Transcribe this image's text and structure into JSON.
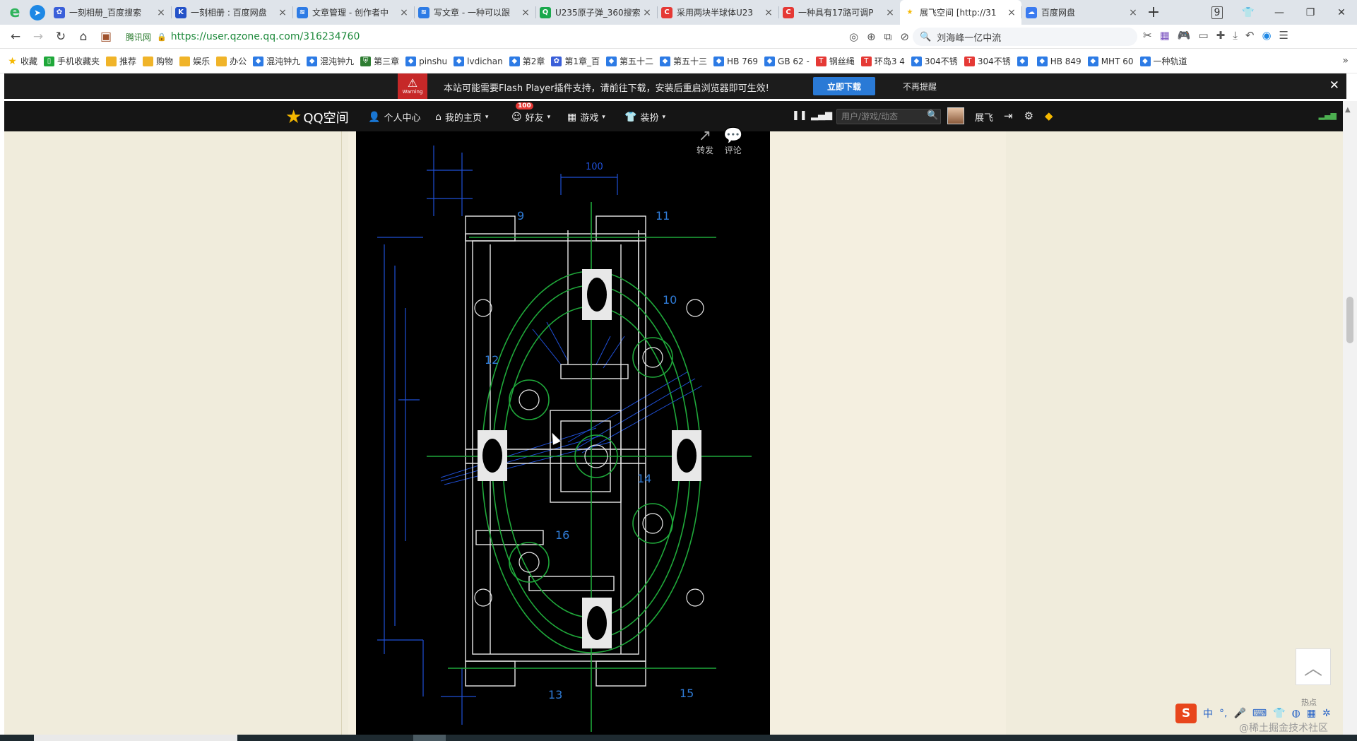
{
  "tabs": [
    {
      "title": "一刻相册_百度搜索",
      "icon": "baidu-paw-icon",
      "color": "#3a5fd9"
    },
    {
      "title": "一刻相册 : 百度网盘",
      "icon": "onemoment-icon",
      "color": "#2452c8"
    },
    {
      "title": "文章管理 - 创作者中",
      "icon": "layers-icon",
      "color": "#2d7be5"
    },
    {
      "title": "写文章 - 一种可以跟",
      "icon": "layers-icon",
      "color": "#2d7be5"
    },
    {
      "title": "U235原子弹_360搜索",
      "icon": "360-search-icon",
      "color": "#19a84c"
    },
    {
      "title": "采用两块半球体U23",
      "icon": "csdn-c-icon",
      "color": "#e53935"
    },
    {
      "title": "一种具有17路可调P",
      "icon": "csdn-c-icon",
      "color": "#e53935"
    },
    {
      "title": "展飞空间 [http://31",
      "icon": "star-icon",
      "color": "#f5b800"
    },
    {
      "title": "百度网盘",
      "icon": "baidu-netdisk-icon",
      "color": "#3b7bf0"
    }
  ],
  "window": {
    "tab_count": "9"
  },
  "address": {
    "secure_label": "腾讯网",
    "url": "https://user.qzone.qq.com/316234760",
    "search_text": "刘海峰一亿中流"
  },
  "bookmarks": [
    {
      "label": "收藏",
      "icon": "star-icon"
    },
    {
      "label": "手机收藏夹",
      "icon": "phone-icon"
    },
    {
      "label": "推荐",
      "icon": "folder-icon"
    },
    {
      "label": "购物",
      "icon": "folder-icon"
    },
    {
      "label": "娱乐",
      "icon": "folder-icon"
    },
    {
      "label": "办公",
      "icon": "folder-icon"
    },
    {
      "label": "混沌钟九",
      "icon": "site-icon"
    },
    {
      "label": "混沌钟九",
      "icon": "site-icon"
    },
    {
      "label": "第三章",
      "icon": "shield-icon"
    },
    {
      "label": "pinshu",
      "icon": "site-icon"
    },
    {
      "label": "lvdichan",
      "icon": "site-icon"
    },
    {
      "label": "第2章",
      "icon": "site-icon"
    },
    {
      "label": "第1章_百",
      "icon": "baidu-paw-icon"
    },
    {
      "label": "第五十二",
      "icon": "site-icon"
    },
    {
      "label": "第五十三",
      "icon": "site-icon"
    },
    {
      "label": "HB 769",
      "icon": "site-icon"
    },
    {
      "label": "GB 62 -",
      "icon": "site-icon"
    },
    {
      "label": "钢丝绳",
      "icon": "t-icon"
    },
    {
      "label": "环岛3 4",
      "icon": "t-icon"
    },
    {
      "label": "304不锈",
      "icon": "site-icon"
    },
    {
      "label": "304不锈",
      "icon": "t-icon"
    },
    {
      "label": "",
      "icon": "site-icon"
    },
    {
      "label": "HB 849",
      "icon": "site-icon"
    },
    {
      "label": "MHT 60",
      "icon": "site-icon"
    },
    {
      "label": "一种轨道",
      "icon": "site-icon"
    }
  ],
  "flash_notice": {
    "warning_label": "Warning",
    "message": "本站可能需要Flash Player插件支持，请前往下载，安装后重启浏览器即可生效!",
    "download_label": "立即下载",
    "dismiss_label": "不再提醒"
  },
  "qzone_nav": {
    "logo_label": "QQ空间",
    "personal_center": "个人中心",
    "my_home": "我的主页",
    "friends": "好友",
    "friends_badge": "100",
    "games": "游戏",
    "decorate": "装扮",
    "search_placeholder": "用户/游戏/动态",
    "username": "展飞"
  },
  "post_actions": {
    "share_label": "转发",
    "comment_label": "评论"
  },
  "drawing_labels": [
    "9",
    "11",
    "10",
    "12",
    "14",
    "16",
    "13",
    "15"
  ],
  "drawing_dims": [
    "100"
  ],
  "floating": {
    "hot_label": "热点"
  },
  "ime": {
    "lang": "中",
    "punct": "°,"
  },
  "watermark": "@稀土掘金技术社区"
}
